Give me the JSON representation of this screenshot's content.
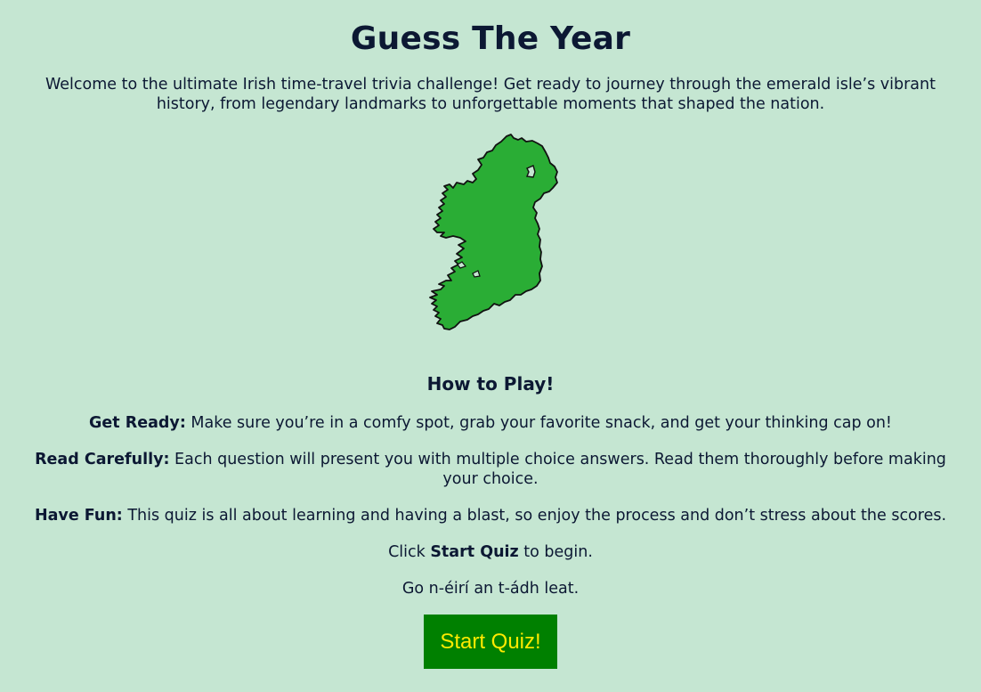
{
  "page": {
    "title": "Guess The Year",
    "intro": "Welcome to the ultimate Irish time-travel trivia challenge! Get ready to journey through the emerald isle’s vibrant history, from legendary landmarks to unforgettable moments that shaped the nation."
  },
  "map": {
    "icon": "ireland-map-icon",
    "fill_color": "#2aad35",
    "stroke_color": "#111111"
  },
  "howto": {
    "heading": "How to Play!",
    "rules": [
      {
        "label": "Get Ready:",
        "text": " Make sure you’re in a comfy spot, grab your favorite snack, and get your thinking cap on!"
      },
      {
        "label": "Read Carefully:",
        "text": " Each question will present you with multiple choice answers. Read them thoroughly before making your choice."
      },
      {
        "label": "Have Fun:",
        "text": " This quiz is all about learning and having a blast, so enjoy the process and don’t stress about the scores."
      }
    ],
    "click_prefix": "Click ",
    "click_bold": "Start Quiz",
    "click_suffix": " to begin.",
    "irish_wish": "Go n-éirí an t-ádh leat."
  },
  "button": {
    "label": "Start Quiz!",
    "bg_color": "#008000",
    "text_color": "#ffea00"
  },
  "colors": {
    "background": "#c5e6d2",
    "text": "#0c1833"
  }
}
